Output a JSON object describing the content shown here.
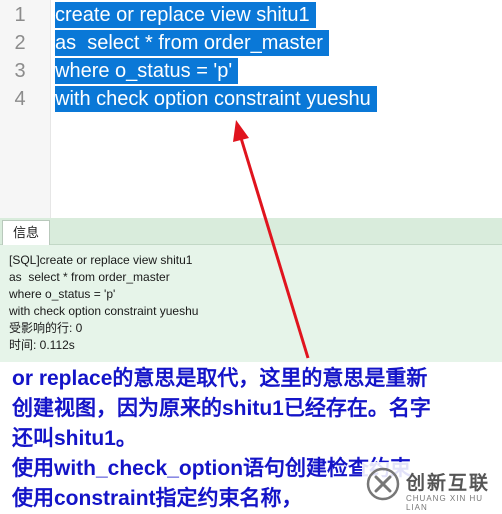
{
  "editor": {
    "lines": [
      {
        "number": "1",
        "text": "create or replace view shitu1"
      },
      {
        "number": "2",
        "text": "as  select * from order_master"
      },
      {
        "number": "3",
        "text": "where o_status = 'p'"
      },
      {
        "number": "4",
        "text": "with check option constraint yueshu"
      }
    ],
    "selection_color": "#0a78d7"
  },
  "messages": {
    "tab_label": "信息",
    "log_lines": [
      "[SQL]create or replace view shitu1",
      "as  select * from order_master",
      "where o_status = 'p'",
      "with check option constraint yueshu",
      "受影响的行: 0",
      "时间: 0.112s"
    ]
  },
  "annotation": {
    "lines": [
      "or replace的意思是取代，这里的意思是重新",
      "创建视图，因为原来的shitu1已经存在。名字",
      "还叫shitu1。",
      "使用with_check_option语句创建检查约束",
      "使用constraint指定约束名称，"
    ],
    "color": "#1414c8",
    "arrow_color": "#e0141e"
  },
  "watermark": {
    "title": "创新互联",
    "subtitle": "CHUANG XIN HU LIAN",
    "logo_icon": "swirl-x-icon"
  }
}
